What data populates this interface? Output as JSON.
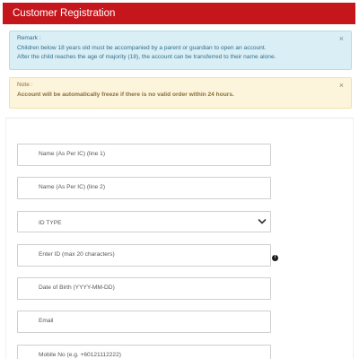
{
  "header": {
    "title": "Customer Registration"
  },
  "alerts": {
    "remark": {
      "title": "Remark :",
      "line1": "Children below 18 years old must be accompanied by a parent or guardian to open an account.",
      "line2": "After the child reaches the age of majority (18), the account can be transferred to their name alone.",
      "close": "×"
    },
    "note": {
      "title": "Note :",
      "message": "Account will be automatically freeze if there is no valid order within 24 hours.",
      "close": "×"
    }
  },
  "form": {
    "name1_placeholder": "Name (As Per IC) (line 1)",
    "name2_placeholder": "Name (As Per IC) (line 2)",
    "id_type_selected": "ID TYPE",
    "id_placeholder": "Enter ID (max 20 characters)",
    "id_info_icon": "!",
    "dob_placeholder": "Date of Birth (YYYY-MM-DD)",
    "email_placeholder": "Email",
    "mobile_placeholder": "Mobile No (e.g. +60121112222)"
  },
  "colors": {
    "header_bg": "#c4161c",
    "info_bg": "#d9eef5",
    "warning_bg": "#fcf5dc"
  },
  "icons": {
    "alert_close": "close-icon",
    "select_arrow": "chevron-down-icon",
    "id_info": "info-icon"
  }
}
